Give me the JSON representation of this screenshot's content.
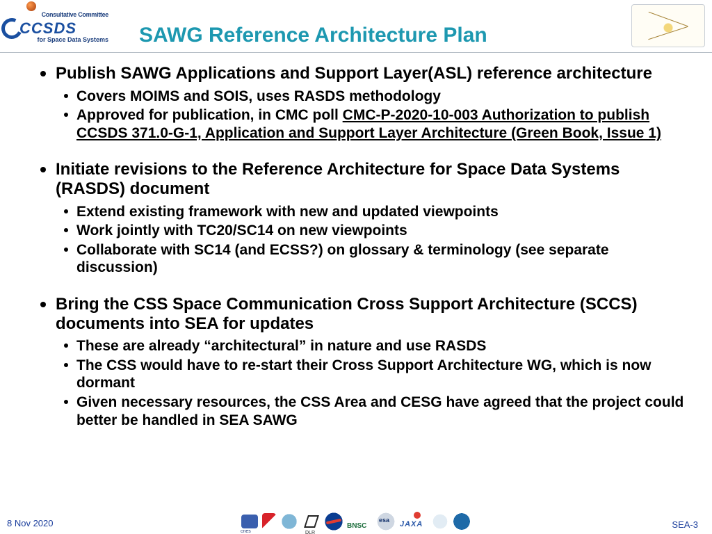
{
  "header": {
    "logo": {
      "line1": "Consultative Committee",
      "acronym": "CCSDS",
      "line2": "for Space Data Systems"
    },
    "title": "SAWG Reference Architecture Plan"
  },
  "bullets": [
    {
      "text": "Publish SAWG Applications and Support Layer(ASL) reference architecture",
      "sub": [
        {
          "text": "Covers MOIMS and SOIS, uses RASDS methodology"
        },
        {
          "prefix": "Approved for publication, in CMC poll ",
          "link": "CMC-P-2020-10-003 Authorization to publish CCSDS 371.0-G-1, Application and Support Layer Architecture (Green Book, Issue 1)"
        }
      ]
    },
    {
      "text": "Initiate revisions to the Reference Architecture for Space Data Systems (RASDS) document",
      "sub": [
        {
          "text": "Extend existing framework with new and updated viewpoints"
        },
        {
          "text": "Work jointly with TC20/SC14 on new viewpoints"
        },
        {
          "text": "Collaborate with SC14 (and ECSS?) on glossary & terminology (see separate discussion)"
        }
      ]
    },
    {
      "text": "Bring the CSS Space Communication Cross Support Architecture (SCCS) documents into SEA for updates",
      "sub": [
        {
          "text": "These are already “architectural” in nature and use RASDS"
        },
        {
          "text": "The CSS would have to re-start their Cross Support Architecture WG, which is now dormant"
        },
        {
          "text": "Given necessary resources, the CSS Area and CESG  have agreed that the project could better be handled in SEA SAWG"
        }
      ]
    }
  ],
  "footer": {
    "date": "8 Nov 2020",
    "page": "SEA-3"
  }
}
